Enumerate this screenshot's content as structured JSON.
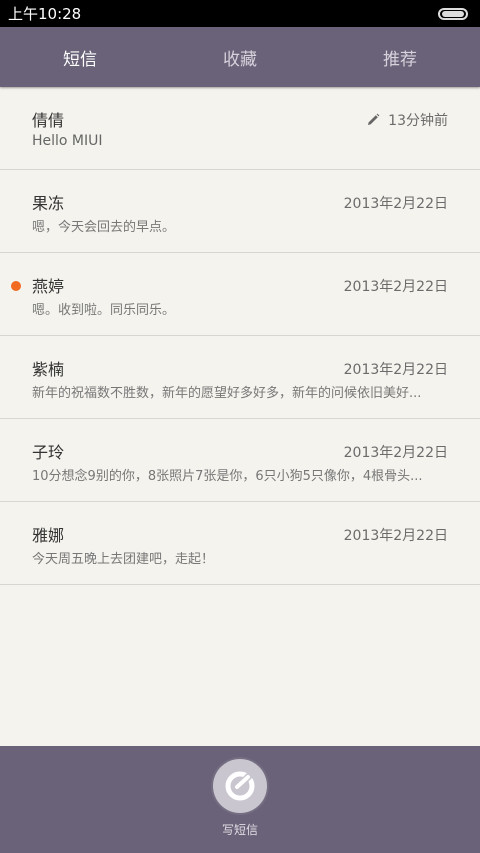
{
  "status_bar": {
    "time": "上午10:28"
  },
  "tabs": [
    {
      "label": "短信",
      "active": true
    },
    {
      "label": "收藏",
      "active": false
    },
    {
      "label": "推荐",
      "active": false
    }
  ],
  "messages": [
    {
      "name": "倩倩",
      "date": "13分钟前",
      "preview": "Hello MIUI",
      "draft": true,
      "unread": false
    },
    {
      "name": "果冻",
      "date": "2013年2月22日",
      "preview": "嗯，今天会回去的早点。",
      "draft": false,
      "unread": false
    },
    {
      "name": "燕婷",
      "date": "2013年2月22日",
      "preview": "嗯。收到啦。同乐同乐。",
      "draft": false,
      "unread": true
    },
    {
      "name": "紫楠",
      "date": "2013年2月22日",
      "preview": "新年的祝福数不胜数，新年的愿望好多好多，新年的问候依旧美好...",
      "draft": false,
      "unread": false
    },
    {
      "name": "子玲",
      "date": "2013年2月22日",
      "preview": "10分想念9别的你，8张照片7张是你，6只小狗5只像你，4根骨头...",
      "draft": false,
      "unread": false
    },
    {
      "name": "雅娜",
      "date": "2013年2月22日",
      "preview": "今天周五晚上去团建吧，走起！",
      "draft": false,
      "unread": false
    }
  ],
  "compose": {
    "label": "写短信",
    "icon": "compose-icon"
  },
  "colors": {
    "bar": "#6a6278",
    "background": "#f4f3ee",
    "unread_dot": "#f06a22"
  }
}
